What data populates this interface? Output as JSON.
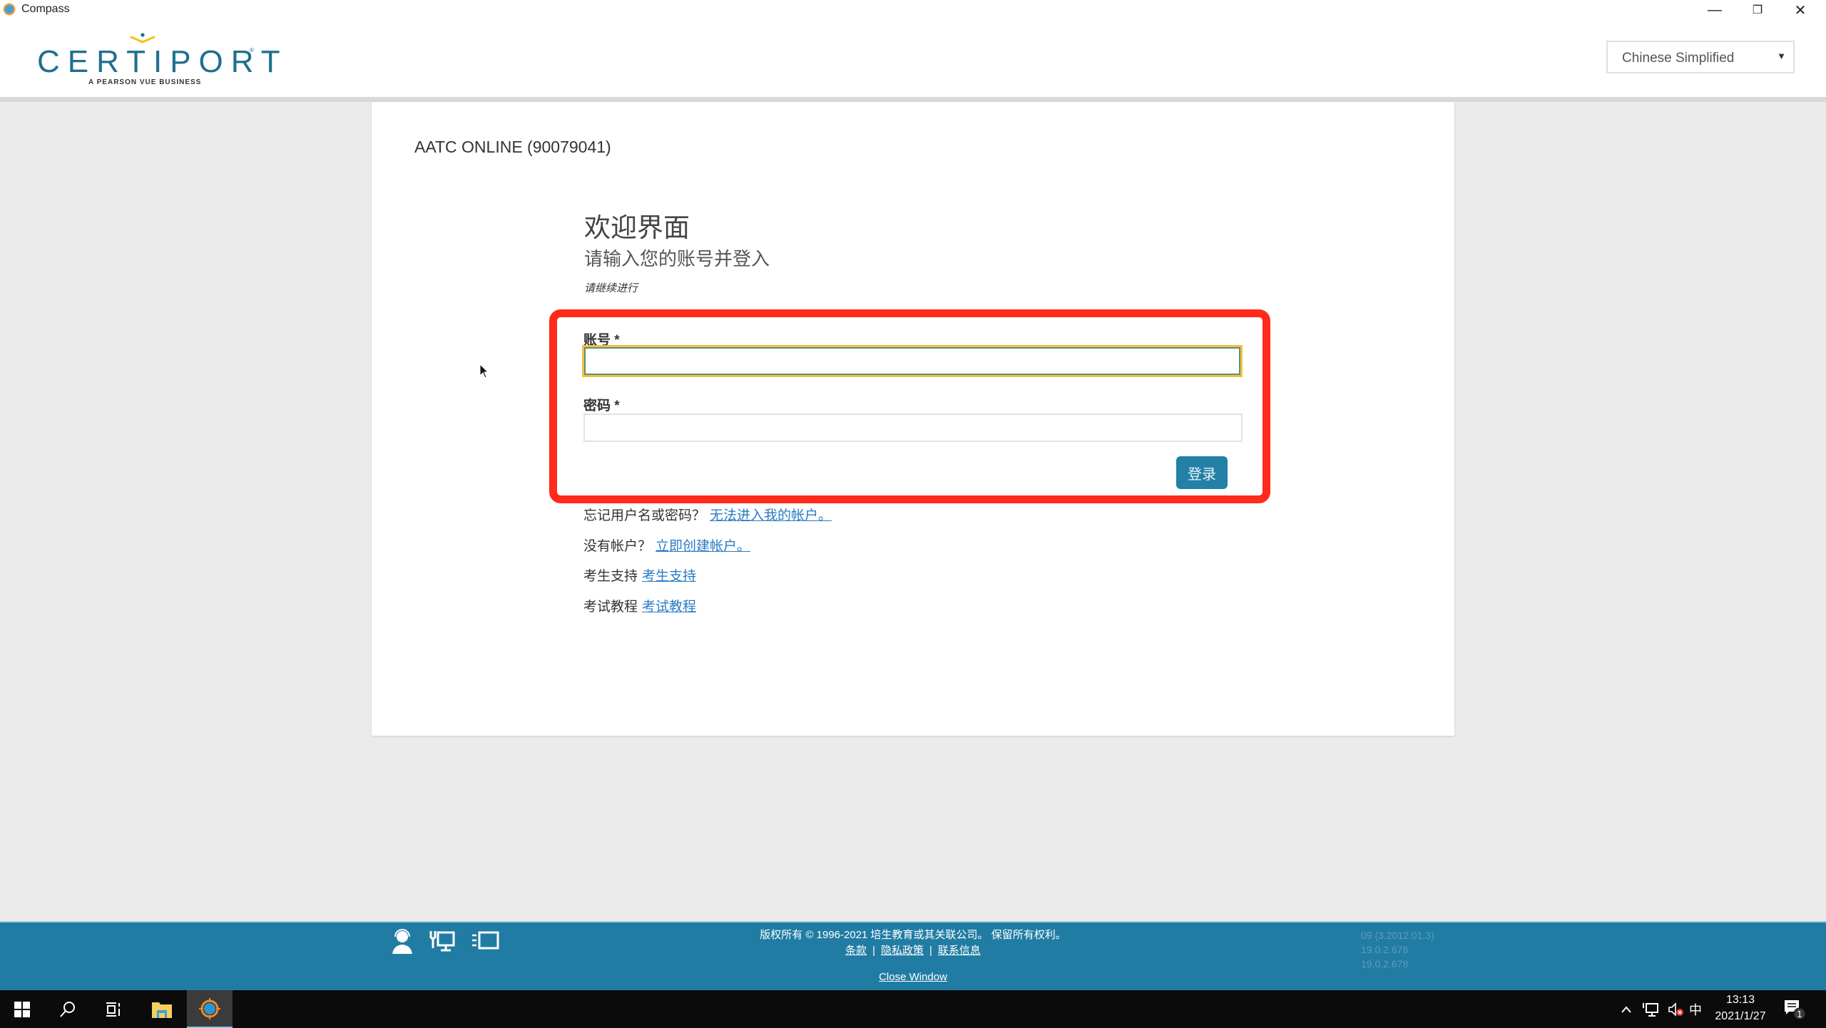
{
  "window": {
    "title": "Compass",
    "controls": {
      "minimize": "—",
      "maximize": "❐",
      "close": "✕"
    }
  },
  "header": {
    "logo": {
      "word": "CERTIPORT",
      "registered": "®",
      "tagline": "A PEARSON VUE BUSINESS"
    },
    "language_select": {
      "value": "Chinese Simplified",
      "arrow": "▼"
    }
  },
  "card": {
    "center_name": "AATC ONLINE (90079041)",
    "welcome_title": "欢迎界面",
    "welcome_subtitle": "请输入您的账号并登入",
    "note": "请继续进行",
    "form": {
      "username_label": "账号 *",
      "username_value": "",
      "password_label": "密码 *",
      "password_value": "",
      "login_button": "登录"
    },
    "help_links": [
      {
        "text": "忘记用户名或密码？",
        "link": "无法进入我的帐户。"
      },
      {
        "text": "没有帐户？",
        "link": "立即创建帐户。"
      },
      {
        "text": "考生支持",
        "link": "考生支持"
      },
      {
        "text": "考试教程",
        "link": "考试教程"
      }
    ]
  },
  "annotation": {
    "highlight_color": "#ff2a1a"
  },
  "footer": {
    "icons": [
      "headset-support-icon",
      "network-computer-icon",
      "window-fast-icon"
    ],
    "copyright": "版权所有 © 1996-2021 培生教育或其关联公司。 保留所有权利。",
    "links": [
      "条款",
      "隐私政策",
      "联系信息"
    ],
    "separator": "|",
    "close_window": "Close Window",
    "versions": [
      "09 (3.2012.01.3)",
      "19.0.2.678",
      "19.0.2.678"
    ],
    "background_color": "#217ca3"
  },
  "taskbar": {
    "apps": [
      "start",
      "search",
      "task-view",
      "file-explorer",
      "compass"
    ],
    "tray": {
      "chevron": "^",
      "ime": "中"
    },
    "clock": {
      "time": "13:13",
      "date": "2021/1/27"
    },
    "notifications_count": "1"
  },
  "colors": {
    "brand": "#1f6f8f",
    "button": "#2380a6",
    "link": "#2a7bc4",
    "focus_border": "#f3c13a"
  }
}
